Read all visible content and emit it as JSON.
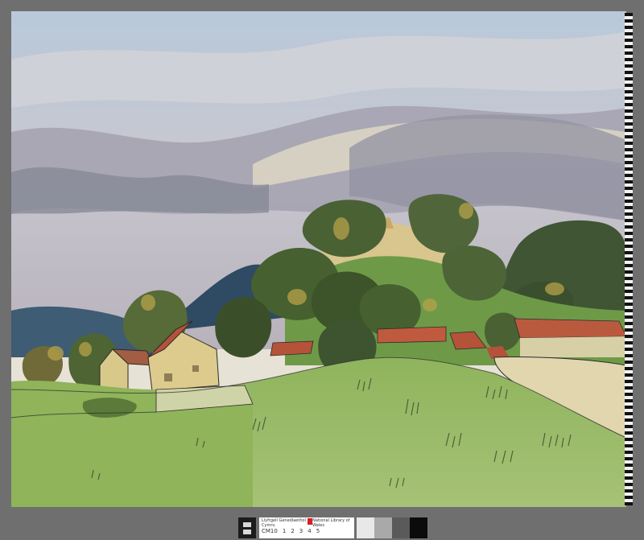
{
  "artwork": {
    "subject": "watercolour landscape: village with houses and trees beneath a cloudy sky, green hill in foreground"
  },
  "scale_bar": {
    "institution_cy": "Llyfrgell Genedlaethol Cymru",
    "institution_en": "National Library of Wales",
    "code": "CM10",
    "ruler_marks": [
      "1",
      "2",
      "3",
      "4",
      "5"
    ],
    "logo_color": "#d61f26"
  },
  "colors": {
    "background": "#6f6f6f",
    "sky_blue": "#a9bfd6",
    "cloud_grey": "#9d9aa8",
    "hill_green": "#8db25a",
    "tree_dark": "#3f5130",
    "roof_red": "#b5523a",
    "house_yellow": "#d8c98a"
  }
}
